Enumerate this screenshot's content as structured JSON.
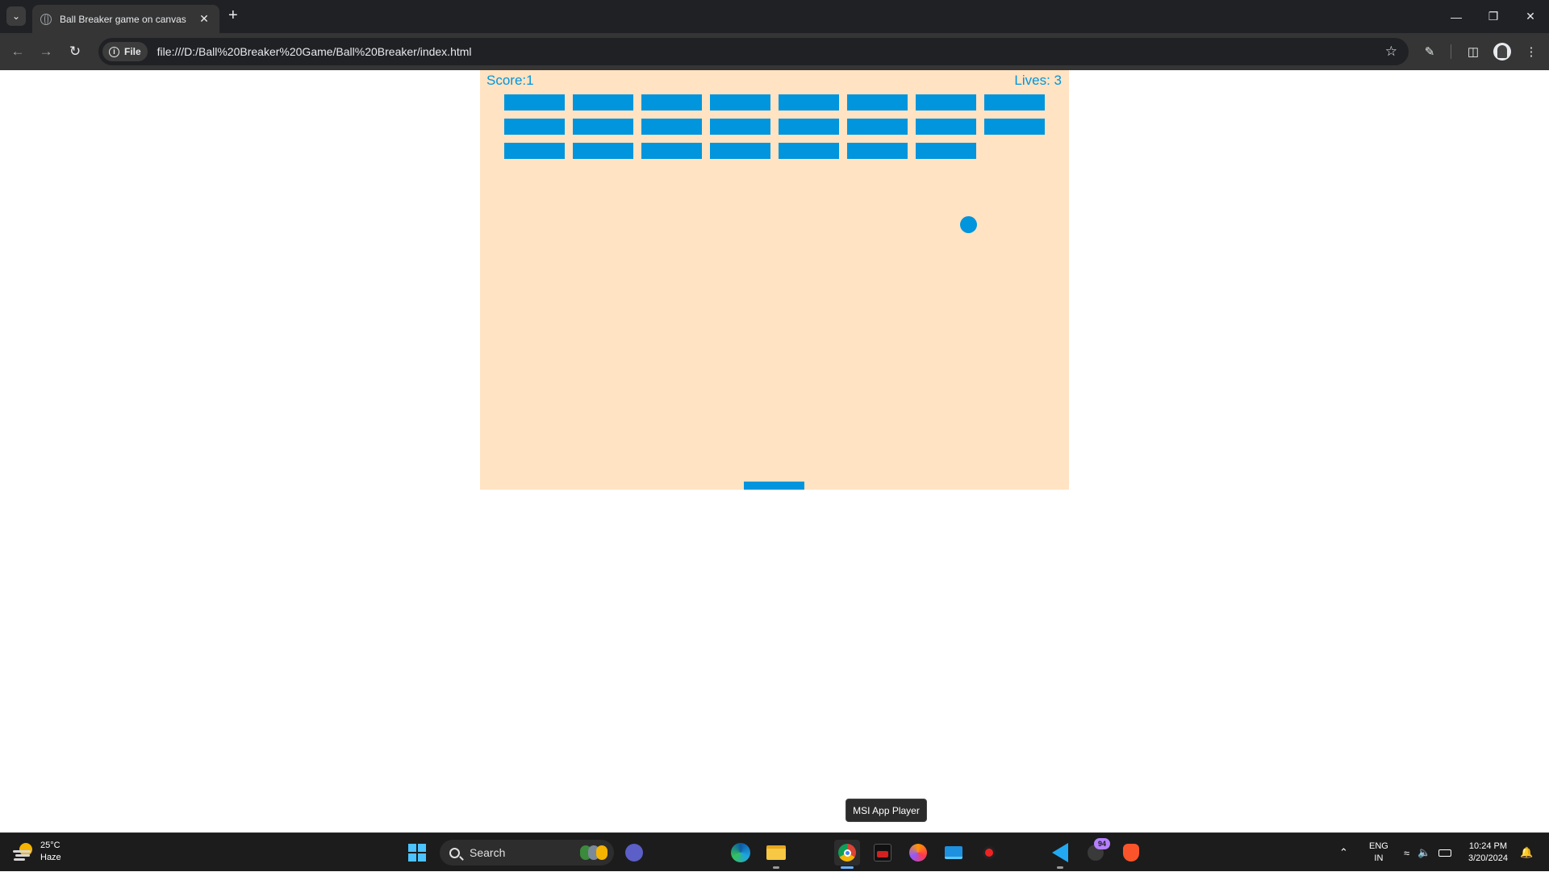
{
  "browser": {
    "tab_title": "Ball Breaker game on canvas",
    "site_chip": "File",
    "url": "file:///D:/Ball%20Breaker%20Game/Ball%20Breaker/index.html"
  },
  "game": {
    "score_label": "Score:1",
    "lives_label": "Lives: 3",
    "score": 1,
    "lives": 3,
    "brick_color": "#0095dd",
    "canvas_color": "#ffe3c2",
    "bricks": [
      [
        true,
        true,
        true,
        true,
        true,
        true,
        true,
        true
      ],
      [
        true,
        true,
        true,
        true,
        true,
        true,
        true,
        true
      ],
      [
        true,
        true,
        true,
        true,
        true,
        true,
        true,
        false
      ]
    ]
  },
  "tooltip": "MSI App Player",
  "taskbar": {
    "weather_temp": "25°C",
    "weather_desc": "Haze",
    "search_placeholder": "Search",
    "notification_badge": "94",
    "lang_line1": "ENG",
    "lang_line2": "IN",
    "time": "10:24 PM",
    "date": "3/20/2024",
    "apps": [
      "start-icon",
      "search",
      "meet-icon",
      "edge-icon",
      "file-explorer-icon",
      "chrome-icon",
      "msi-app-player-icon",
      "firefox-icon",
      "remote-desktop-icon",
      "media-app-icon",
      "vscode-icon",
      "messaging-app-icon",
      "brave-icon"
    ]
  }
}
